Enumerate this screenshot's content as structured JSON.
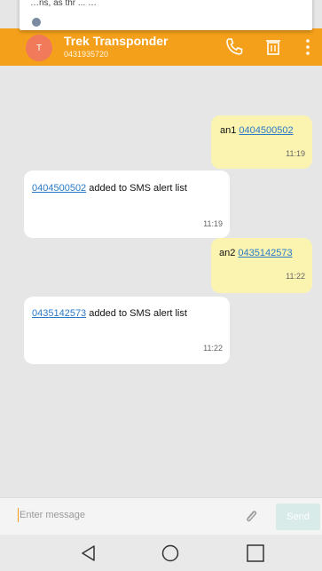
{
  "popup": {
    "text": "…ns, as thr ... …"
  },
  "header": {
    "avatar_initial": "T",
    "title": "Trek Transponder",
    "subtitle": "0431935720",
    "icons": [
      "phone-icon",
      "trash-icon",
      "more-vert-icon"
    ],
    "color": "#f5a01a"
  },
  "messages": [
    {
      "direction": "outgoing",
      "prefix": "an1 ",
      "link": "0404500502",
      "suffix": "",
      "time": "11:19"
    },
    {
      "direction": "incoming",
      "prefix": "",
      "link": "0404500502",
      "suffix": " added to SMS alert list",
      "time": "11:19"
    },
    {
      "direction": "outgoing",
      "prefix": "an2 ",
      "link": "0435142573",
      "suffix": "",
      "time": "11:22"
    },
    {
      "direction": "incoming",
      "prefix": "",
      "link": "0435142573",
      "suffix": " added to SMS alert list",
      "time": "11:22"
    }
  ],
  "composer": {
    "placeholder": "Enter message",
    "send_label": "Send",
    "attach_icon": "paperclip-icon"
  },
  "navbar": {
    "icons": [
      "back-icon",
      "home-icon",
      "recents-icon"
    ]
  }
}
